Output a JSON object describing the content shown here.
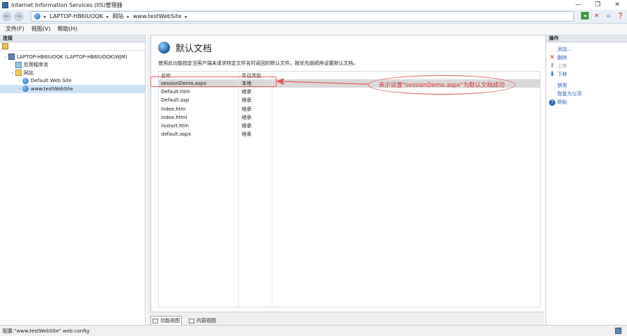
{
  "window": {
    "title": "Internet Information Services (IIS)管理器",
    "controls": [
      "—",
      "❐",
      "✕"
    ]
  },
  "address": {
    "crumbs": [
      "LAPTOP-HB6IUOQK",
      "网站",
      "www.testWebSite"
    ],
    "separator": "▸"
  },
  "menu": [
    "文件(F)",
    "视图(V)",
    "帮助(H)"
  ],
  "connections": {
    "header": "连接",
    "tree": [
      {
        "label": "LAPTOP-HB6IUOQK (LAPTOP-HB6IUOQK\\WJM)",
        "indent": 0,
        "chevron": "⌄",
        "icon": "server-icon"
      },
      {
        "label": "应用程序池",
        "indent": 1,
        "chevron": "",
        "icon": "app-pool-icon"
      },
      {
        "label": "网站",
        "indent": 1,
        "chevron": "⌄",
        "icon": "folder-icon"
      },
      {
        "label": "Default Web Site",
        "indent": 2,
        "chevron": "›",
        "icon": "globe-icon"
      },
      {
        "label": "www.testWebSite",
        "indent": 2,
        "chevron": "›",
        "icon": "globe-icon",
        "selected": true
      }
    ]
  },
  "feature": {
    "title": "默认文档",
    "description": "使用此功能指定当客户端未请求特定文件名时返回的默认文件。按优先级顺序设置默认文档。",
    "columns": [
      "名称",
      "条目类型"
    ],
    "rows": [
      {
        "name": "sessionDemo.aspx",
        "type": "本地",
        "selected": true
      },
      {
        "name": "Default.htm",
        "type": "继承"
      },
      {
        "name": "Default.asp",
        "type": "继承"
      },
      {
        "name": "index.htm",
        "type": "继承"
      },
      {
        "name": "index.html",
        "type": "继承"
      },
      {
        "name": "iisstart.htm",
        "type": "继承"
      },
      {
        "name": "default.aspx",
        "type": "继承"
      }
    ]
  },
  "views": {
    "features": "功能视图",
    "content": "内容视图"
  },
  "actions": {
    "header": "操作",
    "add": "添加...",
    "remove": "删除",
    "move_up": "上移",
    "move_down": "下移",
    "disable": "禁用",
    "revert": "恢复为父项",
    "help": "帮助"
  },
  "status": {
    "text": "配置:\"www.testWebSite\" web.config"
  },
  "annotation": {
    "text": "表示设置\"sessionDemo.aspx\"为默认文档成功",
    "color": "#d32f2f"
  }
}
